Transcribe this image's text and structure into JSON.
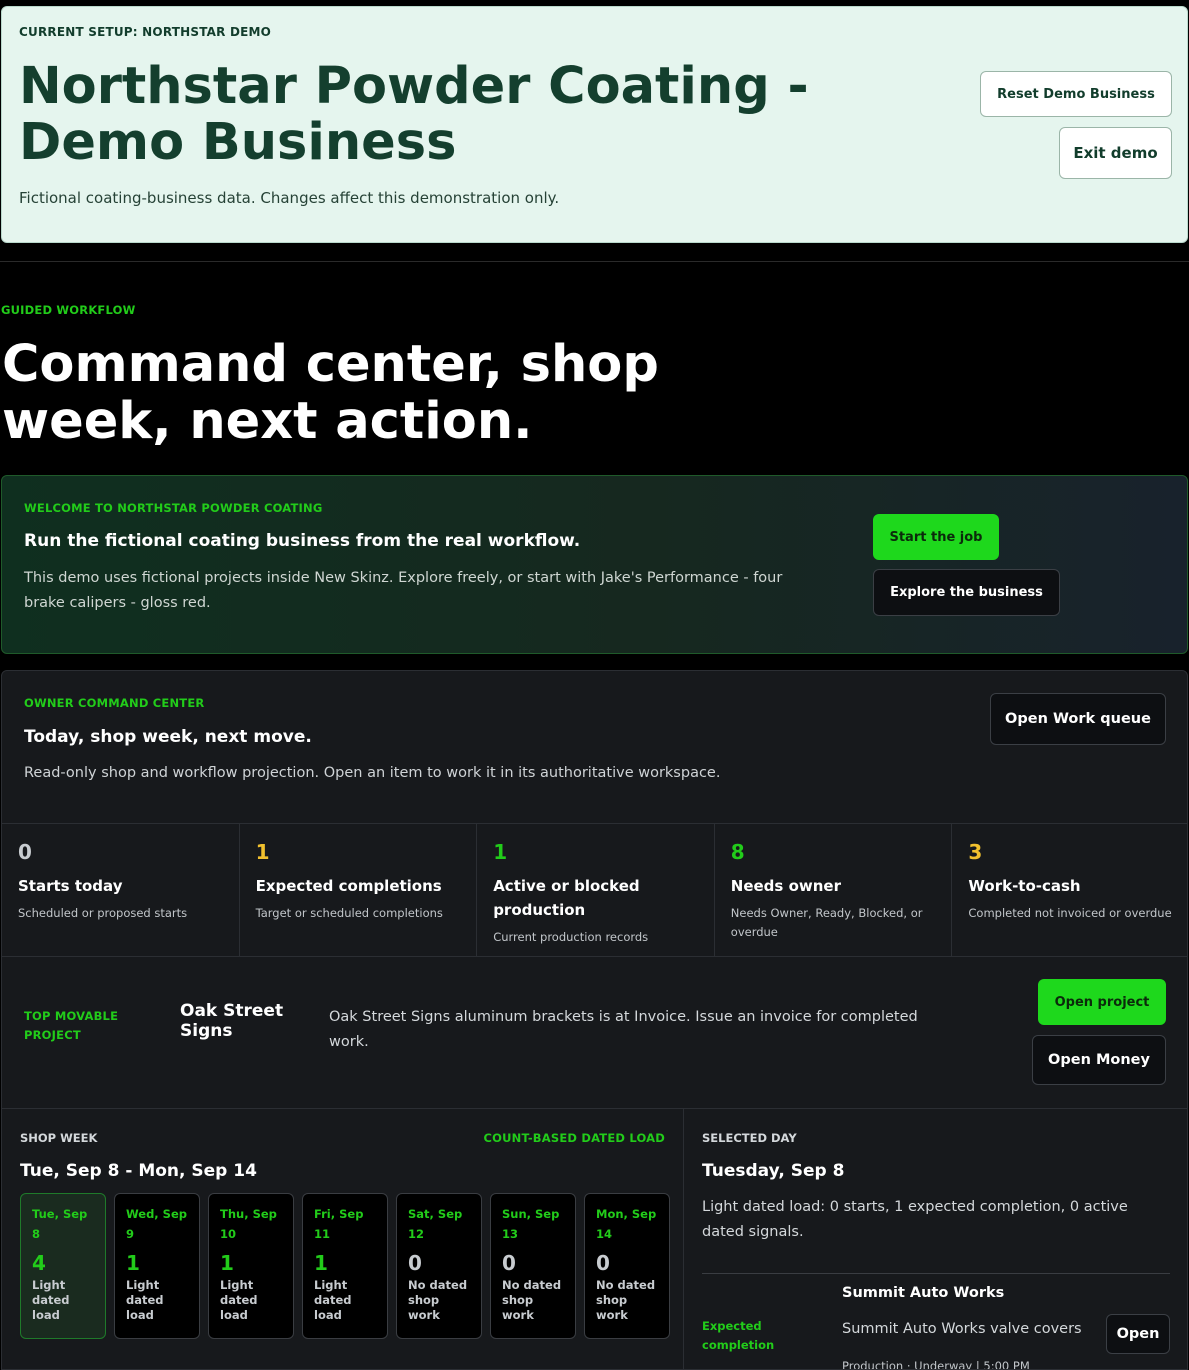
{
  "demo": {
    "eyebrow": "CURRENT SETUP: NORTHSTAR DEMO",
    "title": "Northstar Powder Coating - Demo Business",
    "subtitle": "Fictional coating-business data. Changes affect this demonstration only.",
    "reset_label": "Reset Demo Business",
    "exit_label": "Exit demo"
  },
  "guided": {
    "eyebrow": "GUIDED WORKFLOW",
    "title": "Command center, shop week, next action."
  },
  "welcome": {
    "eyebrow": "WELCOME TO NORTHSTAR POWDER COATING",
    "heading": "Run the fictional coating business from the real workflow.",
    "body": "This demo uses fictional projects inside New Skinz. Explore freely, or start with Jake's Performance - four brake calipers - gloss red.",
    "start_label": "Start the job",
    "explore_label": "Explore the business"
  },
  "command": {
    "eyebrow": "OWNER COMMAND CENTER",
    "heading": "Today, shop week, next move.",
    "subtitle": "Read-only shop and workflow projection. Open an item to work it in its authoritative workspace.",
    "queue_label": "Open Work queue",
    "metrics": [
      {
        "value": "0",
        "label": "Starts today",
        "desc": "Scheduled or proposed starts"
      },
      {
        "value": "1",
        "label": "Expected completions",
        "desc": "Target or scheduled completions"
      },
      {
        "value": "1",
        "label": "Active or blocked production",
        "desc": "Current production records"
      },
      {
        "value": "8",
        "label": "Needs owner",
        "desc": "Needs Owner, Ready, Blocked, or overdue"
      },
      {
        "value": "3",
        "label": "Work-to-cash",
        "desc": "Completed not invoiced or overdue"
      }
    ],
    "movable": {
      "eyebrow": "TOP MOVABLE PROJECT",
      "name": "Oak Street Signs",
      "desc": "Oak Street Signs aluminum brackets is at Invoice. Issue an invoice for completed work.",
      "open_project_label": "Open project",
      "open_money_label": "Open Money"
    }
  },
  "week": {
    "label": "SHOP WEEK",
    "count_label": "COUNT-BASED DATED LOAD",
    "range": "Tue, Sep 8 - Mon, Sep 14",
    "days": [
      {
        "date": "Tue, Sep 8",
        "count": "4",
        "desc": "Light dated load"
      },
      {
        "date": "Wed, Sep 9",
        "count": "1",
        "desc": "Light dated load"
      },
      {
        "date": "Thu, Sep 10",
        "count": "1",
        "desc": "Light dated load"
      },
      {
        "date": "Fri, Sep 11",
        "count": "1",
        "desc": "Light dated load"
      },
      {
        "date": "Sat, Sep 12",
        "count": "0",
        "desc": "No dated shop work"
      },
      {
        "date": "Sun, Sep 13",
        "count": "0",
        "desc": "No dated shop work"
      },
      {
        "date": "Mon, Sep 14",
        "count": "0",
        "desc": "No dated shop work"
      }
    ]
  },
  "selected_day": {
    "label": "SELECTED DAY",
    "date": "Tuesday, Sep 8",
    "desc": "Light dated load: 0 starts, 1 expected completion, 0 active dated signals.",
    "item": {
      "kind": "Expected completion",
      "org": "Summit Auto Works",
      "job": "Summit Auto Works valve covers",
      "status": "Production · Underway | 5:00 PM",
      "open_label": "Open"
    }
  },
  "colors": {
    "accent_green": "#22cc1a",
    "button_green": "#1ed81c",
    "warning_yellow": "#f2c12e",
    "banner_bg": "#e5f5ee"
  }
}
